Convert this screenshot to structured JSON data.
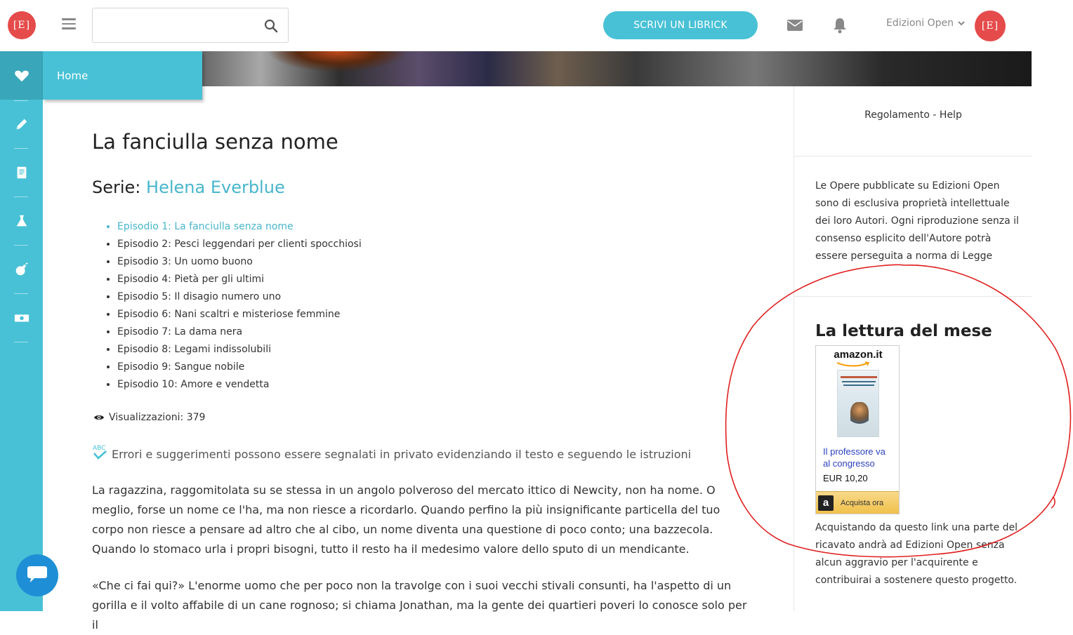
{
  "brand": {
    "logo_text": "[E]",
    "accent": "#48c1d6",
    "logo_color": "#e54b4b"
  },
  "header": {
    "search": {
      "value": "",
      "placeholder": ""
    },
    "cta_label": "SCRIVI UN LIBRICK",
    "user_name": "Edizioni Open"
  },
  "sidebar": {
    "items": [
      {
        "icon": "heart-icon",
        "label": "Home",
        "active": true
      },
      {
        "icon": "pencil-icon"
      },
      {
        "icon": "book-icon"
      },
      {
        "icon": "flask-icon"
      },
      {
        "icon": "bomb-icon"
      },
      {
        "icon": "money-icon"
      }
    ]
  },
  "main": {
    "title": "La fanciulla senza nome",
    "series_prefix": "Serie:",
    "series_name": "Helena Everblue",
    "episodes": [
      "Episodio 1: La fanciulla senza nome",
      "Episodio 2: Pesci leggendari per clienti spocchiosi",
      "Episodio 3: Un uomo buono",
      "Episodio 4: Pietà per gli ultimi",
      "Episodio 5: Il disagio numero uno",
      "Episodio 6: Nani scaltri e misteriose femmine",
      "Episodio 7: La dama nera",
      "Episodio 8: Legami indissolubili",
      "Episodio 9: Sangue nobile",
      "Episodio 10: Amore e vendetta"
    ],
    "current_episode_index": 0,
    "views_label": "Visualizzazioni: 379",
    "note": "Errori e suggerimenti possono essere segnalati in privato evidenziando il testo e seguendo le istruzioni",
    "paragraphs": [
      "La ragazzina, raggomitolata su se stessa in un angolo polveroso del mercato ittico di Newcity, non ha nome. O meglio, forse un nome ce l'ha, ma non riesce a ricordarlo. Quando perfino la più insignificante particella del tuo corpo non riesce a pensare ad altro che al cibo, un nome diventa una questione di poco conto; una bazzecola. Quando lo stomaco urla i propri bisogni, tutto il resto ha il medesimo valore dello sputo di un mendicante.",
      "«Che ci fai qui?» L'enorme uomo che per poco non la travolge con i suoi vecchi stivali consunti, ha l'aspetto di un gorilla e il volto affabile di un cane rognoso; si chiama Jonathan, ma la gente dei quartieri poveri lo conosce solo per il"
    ]
  },
  "right": {
    "rules_link": "Regolamento - Help",
    "notice": "Le Opere pubblicate su Edizioni Open sono di esclusiva proprietà intellettuale dei loro Autori. Ogni riproduzione senza il consenso esplicito dell'Autore potrà essere perseguita a norma di Legge",
    "month_title": "La lettura del mese",
    "amazon": {
      "logo": "amazon.it",
      "book_title": "Il professore va al congresso",
      "price": "EUR 10,20",
      "buy_label": "Acquista ora"
    },
    "purchase_note": "Acquistando da questo link una parte del ricavato andrà ad Edizioni Open senza alcun aggravio per l'acquirente e contribuirai a sostenere questo progetto."
  },
  "annotation_color": "#e02020"
}
